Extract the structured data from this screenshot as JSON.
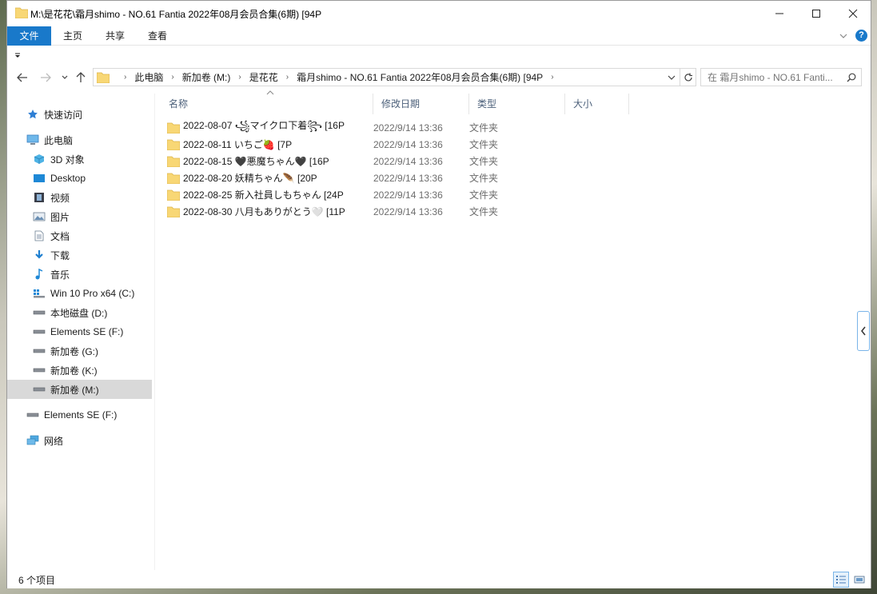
{
  "window": {
    "title": "M:\\是花花\\霜月shimo - NO.61 Fantia 2022年08月会员合集(6期) [94P"
  },
  "ribbon": {
    "tabs": [
      "文件",
      "主页",
      "共享",
      "查看"
    ]
  },
  "address": {
    "crumbs": [
      "此电脑",
      "新加卷 (M:)",
      "是花花",
      "霜月shimo - NO.61 Fantia 2022年08月会员合集(6期) [94P"
    ],
    "search_placeholder": "在 霜月shimo - NO.61 Fanti..."
  },
  "nav": {
    "quick_access": "快速访问",
    "this_pc": "此电脑",
    "items": [
      "3D 对象",
      "Desktop",
      "视频",
      "图片",
      "文档",
      "下载",
      "音乐",
      "Win 10 Pro x64 (C:)",
      "本地磁盘 (D:)",
      "Elements SE (F:)",
      "新加卷 (G:)",
      "新加卷 (K:)",
      "新加卷 (M:)"
    ],
    "external": "Elements SE (F:)",
    "network": "网络"
  },
  "columns": {
    "name": "名称",
    "date": "修改日期",
    "type": "类型",
    "size": "大小"
  },
  "files": [
    {
      "name": "2022-08-07 ꧁マイクロ下着꧂ [16P",
      "date": "2022/9/14 13:36",
      "type": "文件夹"
    },
    {
      "name": "2022-08-11 いちご🍓 [7P",
      "date": "2022/9/14 13:36",
      "type": "文件夹"
    },
    {
      "name": "2022-08-15 🖤悪魔ちゃん🖤 [16P",
      "date": "2022/9/14 13:36",
      "type": "文件夹"
    },
    {
      "name": "2022-08-20 妖精ちゃん🪶 [20P",
      "date": "2022/9/14 13:36",
      "type": "文件夹"
    },
    {
      "name": "2022-08-25 新入社員しもちゃん [24P",
      "date": "2022/9/14 13:36",
      "type": "文件夹"
    },
    {
      "name": "2022-08-30 八月もありがとう🤍 [11P",
      "date": "2022/9/14 13:36",
      "type": "文件夹"
    }
  ],
  "status": {
    "count": "6 个项目"
  },
  "colors": {
    "accent": "#1979ca",
    "folder": "#f8d775",
    "selected_nav": "#d9d9d9"
  }
}
